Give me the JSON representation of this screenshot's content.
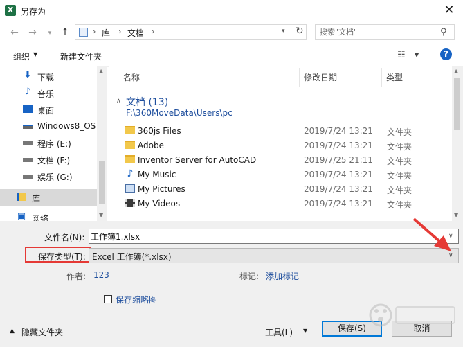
{
  "window": {
    "title": "另存为",
    "app_icon": "X"
  },
  "address": {
    "crumbs": [
      "库",
      "文档"
    ],
    "sep": "›"
  },
  "search": {
    "placeholder": "搜索\"文档\""
  },
  "toolbar": {
    "organize": "组织",
    "new_folder": "新建文件夹",
    "help": "?"
  },
  "nav": {
    "items": [
      {
        "label": "下载",
        "icon": "download-icon"
      },
      {
        "label": "音乐",
        "icon": "music-icon"
      },
      {
        "label": "桌面",
        "icon": "desktop-icon"
      },
      {
        "label": "Windows8_OS",
        "icon": "drive-icon"
      },
      {
        "label": "程序 (E:)",
        "icon": "drive-icon"
      },
      {
        "label": "文档 (F:)",
        "icon": "drive-icon"
      },
      {
        "label": "娱乐 (G:)",
        "icon": "drive-icon"
      },
      {
        "label": "库",
        "icon": "library-icon"
      },
      {
        "label": "网络",
        "icon": "network-icon"
      }
    ]
  },
  "files": {
    "columns": [
      "名称",
      "修改日期",
      "类型"
    ],
    "group_title": "文档 (13)",
    "group_path": "F:\\360MoveData\\Users\\pc",
    "rows": [
      {
        "name": "360js Files",
        "date": "2019/7/24 13:21",
        "type": "文件夹",
        "icon": "folder-icon"
      },
      {
        "name": "Adobe",
        "date": "2019/7/24 13:21",
        "type": "文件夹",
        "icon": "folder-icon"
      },
      {
        "name": "Inventor Server for AutoCAD",
        "date": "2019/7/25 21:11",
        "type": "文件夹",
        "icon": "folder-icon"
      },
      {
        "name": "My Music",
        "date": "2019/7/24 13:21",
        "type": "文件夹",
        "icon": "music-folder-icon"
      },
      {
        "name": "My Pictures",
        "date": "2019/7/24 13:21",
        "type": "文件夹",
        "icon": "pictures-folder-icon"
      },
      {
        "name": "My Videos",
        "date": "2019/7/24 13:21",
        "type": "文件夹",
        "icon": "videos-folder-icon"
      }
    ]
  },
  "form": {
    "filename_label": "文件名(N):",
    "filename_value": "工作簿1.xlsx",
    "type_label": "保存类型(T):",
    "type_value": "Excel 工作簿(*.xlsx)",
    "author_label": "作者:",
    "author_value": "123",
    "tags_label": "标记:",
    "tags_value": "添加标记",
    "thumbnail_label": "保存缩略图"
  },
  "footer": {
    "hide_folders": "隐藏文件夹",
    "tools": "工具(L)",
    "save": "保存(S)",
    "cancel": "取消"
  },
  "colors": {
    "accent": "#1763c4",
    "link": "#1e4e9d",
    "highlight": "#e53935"
  }
}
